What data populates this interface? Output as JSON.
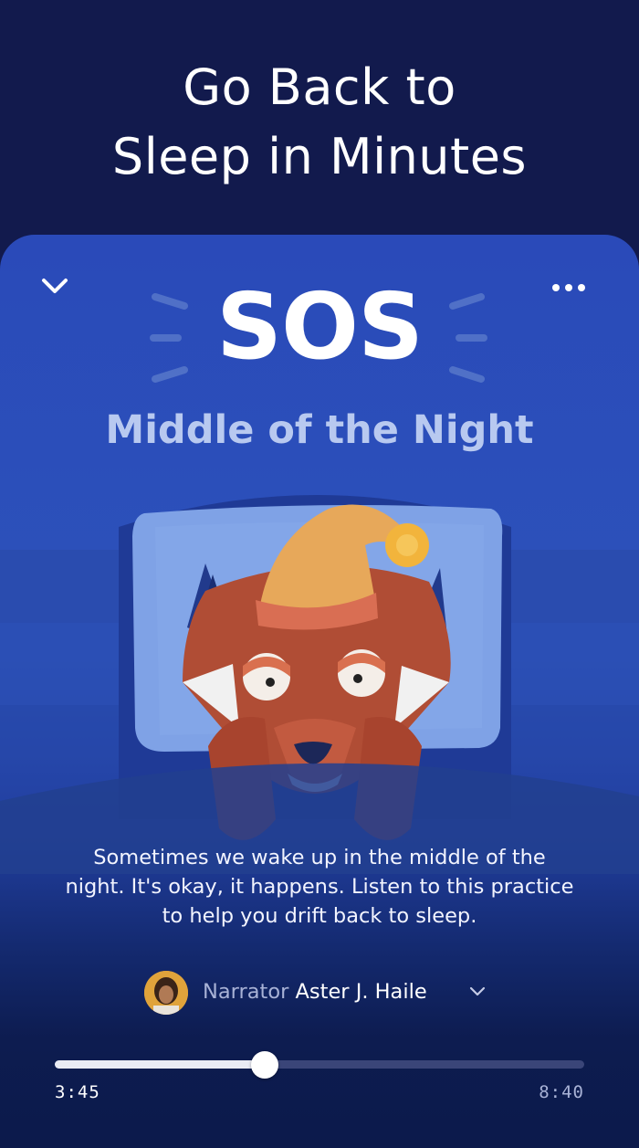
{
  "header": {
    "line1": "Go Back to",
    "line2": "Sleep in Minutes"
  },
  "player": {
    "title": "SOS",
    "subtitle": "Middle of the Night",
    "description": "Sometimes we wake up in the middle of the night. It's okay, it happens. Listen to this practice to help you drift back to sleep.",
    "narrator_label": "Narrator",
    "narrator_name": "Aster J. Haile",
    "elapsed": "3:45",
    "total": "8:40",
    "progress_fraction": 0.3958
  },
  "icons": {
    "collapse": "chevron-down-icon",
    "more": "more-horizontal-icon",
    "narrator_dropdown": "chevron-down-icon"
  },
  "colors": {
    "background": "#121a4d",
    "card": "#2c52ba",
    "subtitle": "#b8c9f0",
    "fox": "#b04d35",
    "hat": "#e7a85a",
    "pillow": "#7fa2e6"
  }
}
